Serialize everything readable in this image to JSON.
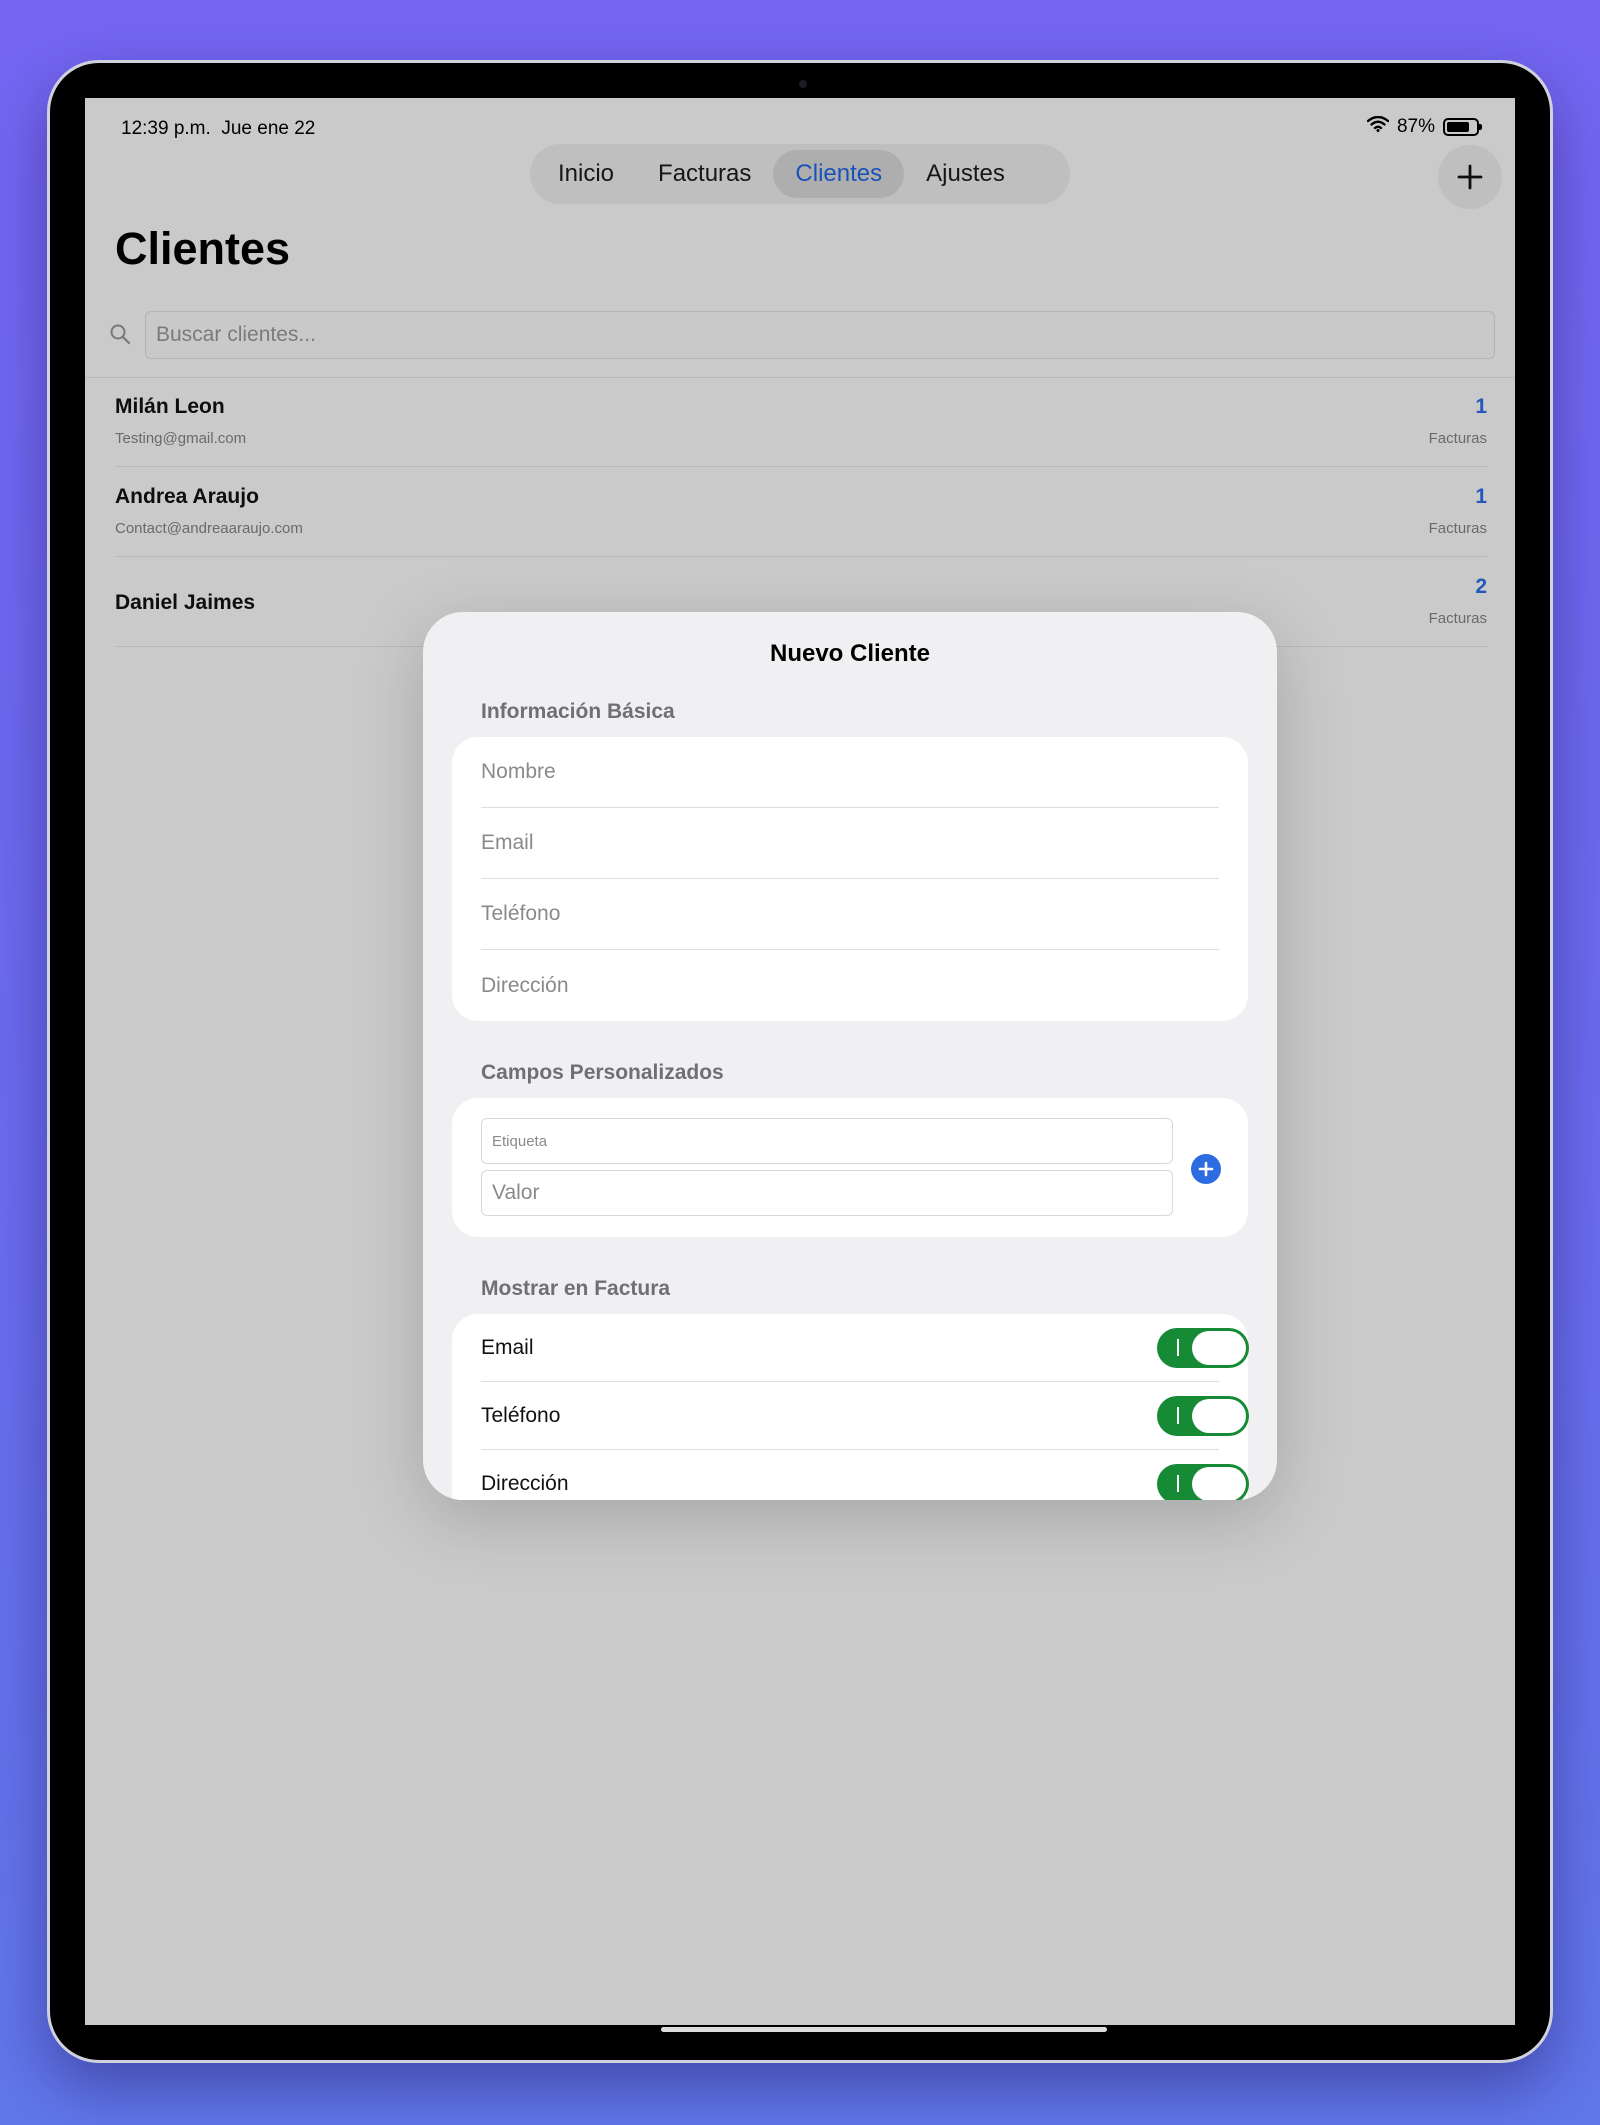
{
  "status_bar": {
    "time": "12:39 p.m.",
    "date": "Jue ene 22",
    "battery": "87%",
    "battery_level": 0.87
  },
  "tabs": [
    {
      "label": "Inicio",
      "active": false
    },
    {
      "label": "Facturas",
      "active": false
    },
    {
      "label": "Clientes",
      "active": true
    },
    {
      "label": "Ajustes",
      "active": false
    }
  ],
  "page": {
    "title": "Clientes",
    "search_placeholder": "Buscar clientes..."
  },
  "clients": [
    {
      "name": "Milán Leon",
      "email": "Testing@gmail.com",
      "count": "1",
      "count_label": "Facturas"
    },
    {
      "name": "Andrea Araujo",
      "email": "Contact@andreaaraujo.com",
      "count": "1",
      "count_label": "Facturas"
    },
    {
      "name": "Daniel Jaimes",
      "email": "",
      "count": "2",
      "count_label": "Facturas"
    }
  ],
  "sheet": {
    "title": "Nuevo Cliente",
    "basic_section": "Información Básica",
    "basic_fields": {
      "name": "Nombre",
      "email": "Email",
      "phone": "Teléfono",
      "address": "Dirección"
    },
    "custom_section": "Campos Personalizados",
    "custom_fields": {
      "label_placeholder": "Etiqueta",
      "value_placeholder": "Valor"
    },
    "invoice_section": "Mostrar en Factura",
    "toggles": [
      {
        "label": "Email",
        "on": true
      },
      {
        "label": "Teléfono",
        "on": true
      },
      {
        "label": "Dirección",
        "on": true
      }
    ]
  },
  "colors": {
    "accent": "#2a64d8",
    "toggle_on": "#178a35",
    "background": "#7466f2"
  }
}
